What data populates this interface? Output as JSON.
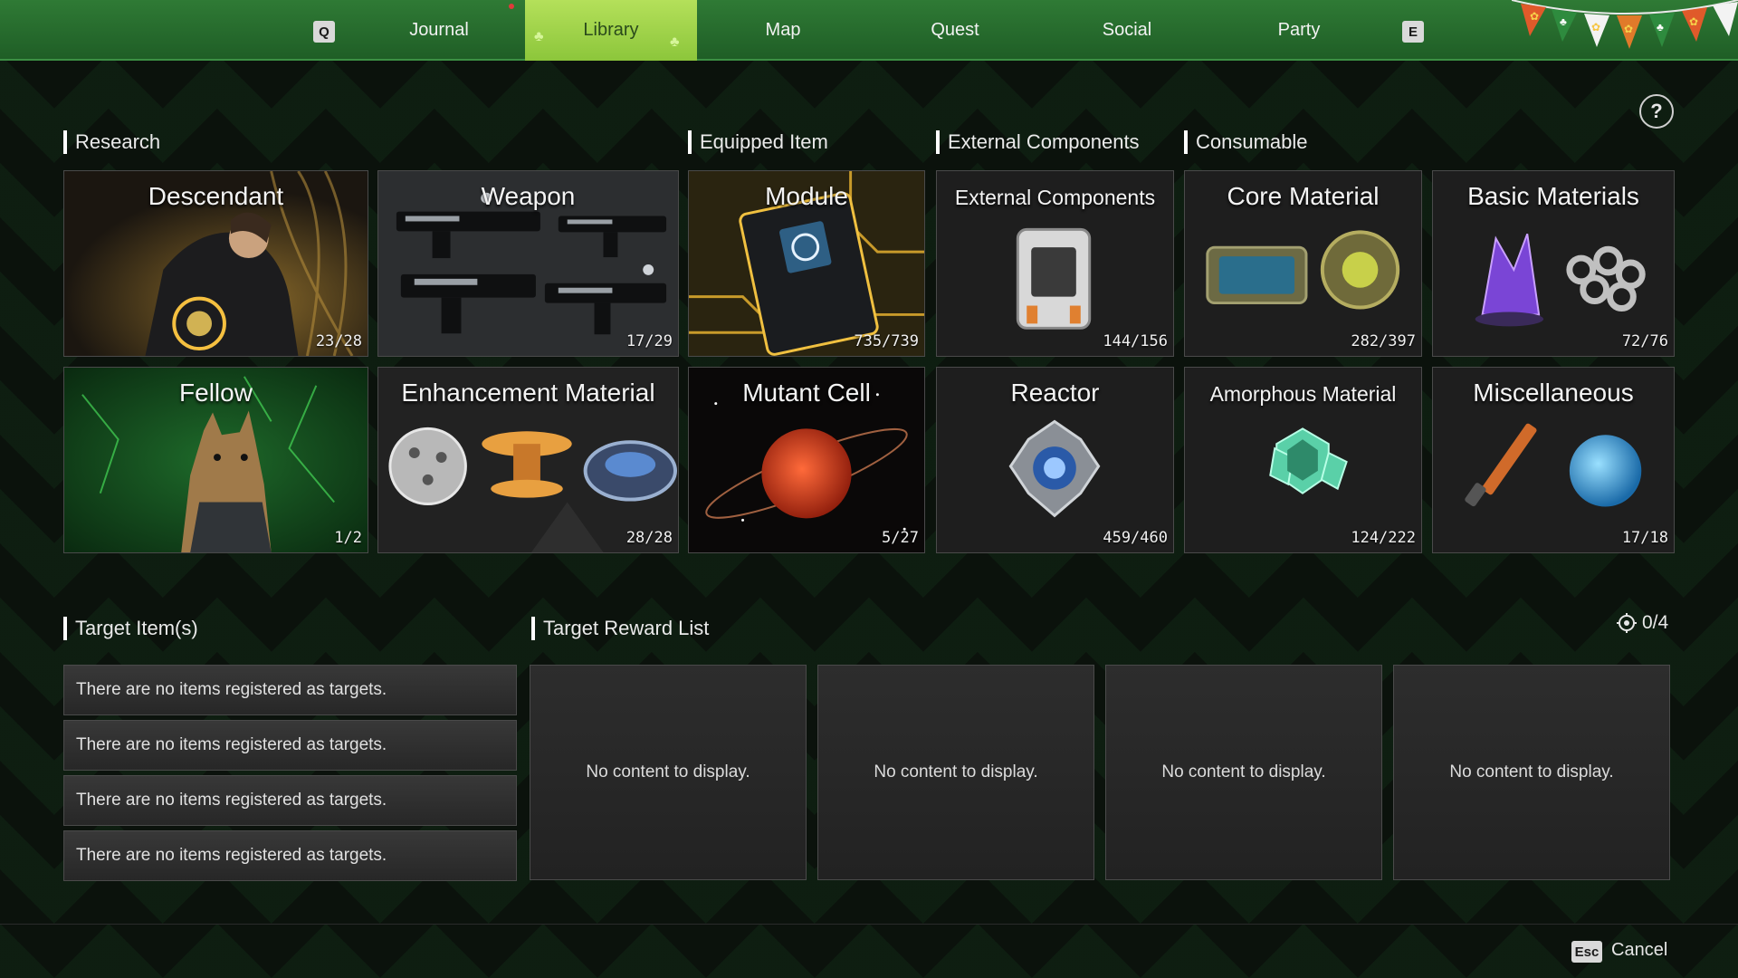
{
  "nav": {
    "left_key": "Q",
    "right_key": "E",
    "tabs": [
      {
        "label": "Journal"
      },
      {
        "label": "Library"
      },
      {
        "label": "Map"
      },
      {
        "label": "Quest"
      },
      {
        "label": "Social"
      },
      {
        "label": "Party"
      }
    ],
    "active_tab": "Library"
  },
  "help": {
    "label": "?"
  },
  "sections": {
    "research": "Research",
    "equipped_item": "Equipped Item",
    "external_components": "External Components",
    "consumable": "Consumable"
  },
  "tiles": [
    {
      "title": "Descendant",
      "count": "23/28"
    },
    {
      "title": "Weapon",
      "count": "17/29"
    },
    {
      "title": "Module",
      "count": "735/739"
    },
    {
      "title": "External Components",
      "count": "144/156"
    },
    {
      "title": "Core Material",
      "count": "282/397"
    },
    {
      "title": "Basic Materials",
      "count": "72/76"
    },
    {
      "title": "Fellow",
      "count": "1/2"
    },
    {
      "title": "Enhancement Material",
      "count": "28/28"
    },
    {
      "title": "Mutant Cell",
      "count": "5/27"
    },
    {
      "title": "Reactor",
      "count": "459/460"
    },
    {
      "title": "Amorphous Material",
      "count": "124/222"
    },
    {
      "title": "Miscellaneous",
      "count": "17/18"
    }
  ],
  "targets": {
    "label": "Target Item(s)",
    "rows": [
      "There are no items registered as targets.",
      "There are no items registered as targets.",
      "There are no items registered as targets.",
      "There are no items registered as targets."
    ]
  },
  "rewards": {
    "label": "Target Reward List",
    "counter": "0/4",
    "boxes": [
      "No content to display.",
      "No content to display.",
      "No content to display.",
      "No content to display."
    ]
  },
  "footer": {
    "esc_key": "Esc",
    "cancel_label": "Cancel"
  },
  "colors": {
    "nav_green": "#2f7a35",
    "active_tab": "#a6d84e",
    "background": "#0b120c"
  }
}
